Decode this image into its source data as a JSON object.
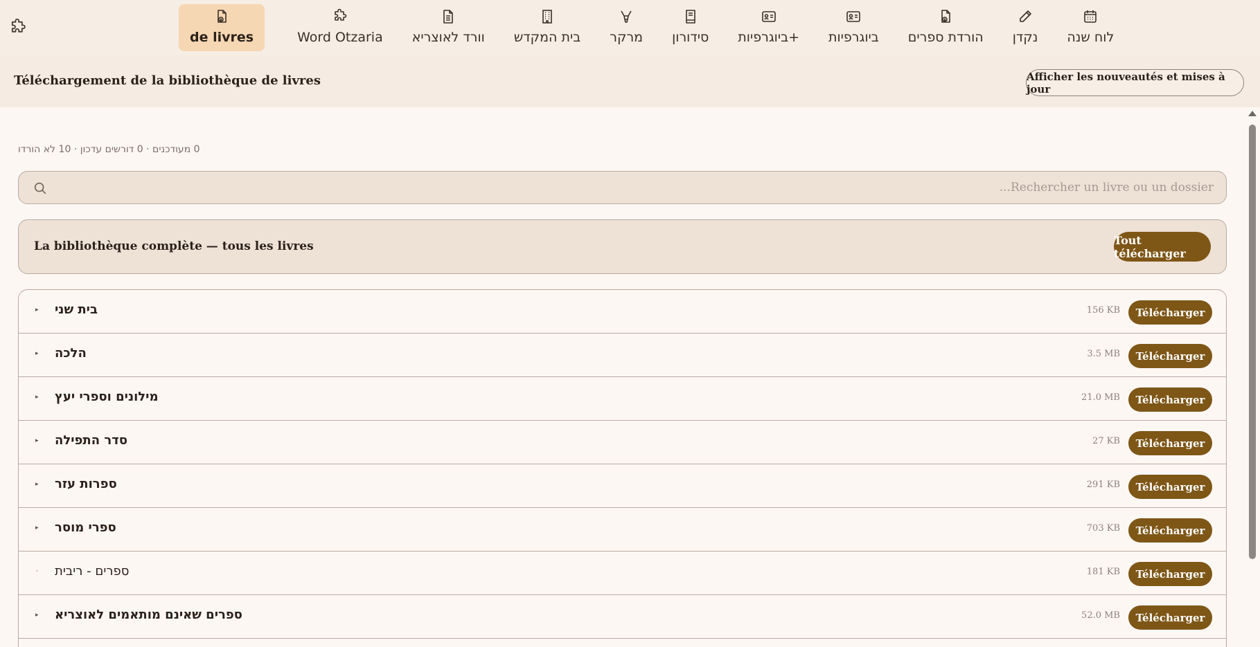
{
  "nav": {
    "items": [
      {
        "label": "de livres",
        "icon": "file-download-icon",
        "active": true
      },
      {
        "label": "Word Otzaria",
        "icon": "puzzle-icon"
      },
      {
        "label": "וורד לאוצריא",
        "icon": "document-icon"
      },
      {
        "label": "בית המקדש",
        "icon": "building-icon"
      },
      {
        "label": "מרקר",
        "icon": "marker-icon"
      },
      {
        "label": "סידורון",
        "icon": "book-icon"
      },
      {
        "label": "ביוגרפיות+",
        "icon": "id-card-icon"
      },
      {
        "label": "ביוגרפיות",
        "icon": "id-card-icon"
      },
      {
        "label": "הורדת ספרים",
        "icon": "file-download-icon"
      },
      {
        "label": "נקדן",
        "icon": "pencil-icon"
      },
      {
        "label": "לוח שנה",
        "icon": "calendar-icon"
      }
    ]
  },
  "header": {
    "title": "Téléchargement de la bibliothèque de livres",
    "updates_button": "Afficher les nouveautés et mises à jour"
  },
  "stats_text": "0 מעודכנים · 0 דורשים עדכון · 10 לא הורדו",
  "search": {
    "placeholder": "...Rechercher un livre ou un dossier",
    "value": ""
  },
  "full_library": {
    "label": "La bibliothèque complète — tous les livres",
    "button": "Tout télécharger"
  },
  "books": [
    {
      "name": "בית שני",
      "size": "156 KB",
      "button": "Télécharger",
      "expandable": true,
      "bold": true
    },
    {
      "name": "הלכה",
      "size": "3.5 MB",
      "button": "Télécharger",
      "expandable": true,
      "bold": true
    },
    {
      "name": "מילונים וספרי יעץ",
      "size": "21.0 MB",
      "button": "Télécharger",
      "expandable": true,
      "bold": true
    },
    {
      "name": "סדר התפילה",
      "size": "27 KB",
      "button": "Télécharger",
      "expandable": true,
      "bold": true
    },
    {
      "name": "ספרות עזר",
      "size": "291 KB",
      "button": "Télécharger",
      "expandable": true,
      "bold": true
    },
    {
      "name": "ספרי מוסר",
      "size": "703 KB",
      "button": "Télécharger",
      "expandable": true,
      "bold": true
    },
    {
      "name": "ספרים - ריבית",
      "size": "181 KB",
      "button": "Télécharger",
      "expandable": false,
      "bold": false
    },
    {
      "name": "ספרים שאינם מותאמים לאוצריא",
      "size": "52.0 MB",
      "button": "Télécharger",
      "expandable": true,
      "bold": true
    }
  ],
  "colors": {
    "accent": "#7e5616",
    "active_tab": "#f6d7b3",
    "topbar": "#f6ede4",
    "background": "#fdf7f4"
  }
}
